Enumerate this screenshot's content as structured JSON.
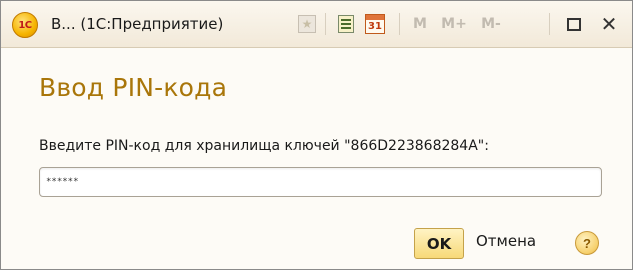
{
  "window": {
    "title": "В... (1С:Предприятие)",
    "app_icon_text": "1C",
    "toolbar": {
      "favorite_icon": "star-icon",
      "calculator_icon": "calculator-icon",
      "calendar_icon": "calendar-icon",
      "calendar_day": "31",
      "m_label": "M",
      "m_plus_label": "M+",
      "m_minus_label": "M-",
      "maximize_icon": "maximize-icon",
      "close_label": "✕"
    }
  },
  "dialog": {
    "heading": "Ввод PIN-кода",
    "prompt": "Введите PIN-код для хранилища ключей \"866D223868284A\":",
    "pin_value": "******",
    "ok_label": "OK",
    "cancel_label": "Отмена",
    "help_label": "?"
  },
  "colors": {
    "heading": "#a9760a",
    "ok_button": "#f7d978",
    "titlebar": "#f2e9d9"
  }
}
